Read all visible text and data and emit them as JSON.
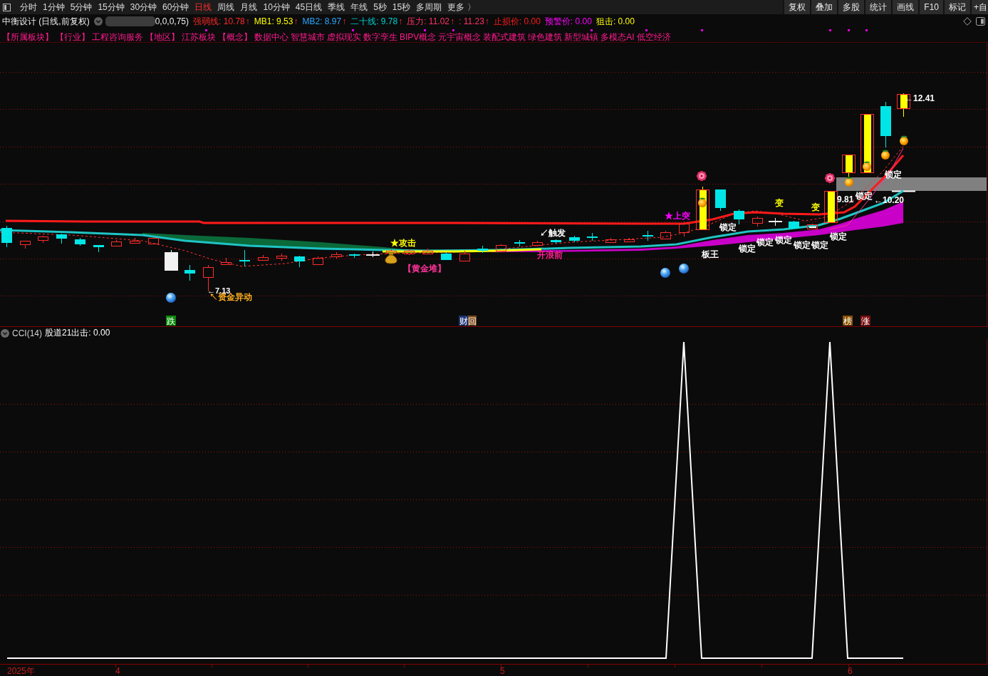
{
  "toolbar": {
    "periods": [
      {
        "label": "分时",
        "selected": false
      },
      {
        "label": "1分钟",
        "selected": false
      },
      {
        "label": "5分钟",
        "selected": false
      },
      {
        "label": "15分钟",
        "selected": false
      },
      {
        "label": "30分钟",
        "selected": false
      },
      {
        "label": "60分钟",
        "selected": false
      },
      {
        "label": "日线",
        "selected": true
      },
      {
        "label": "周线",
        "selected": false
      },
      {
        "label": "月线",
        "selected": false
      },
      {
        "label": "10分钟",
        "selected": false
      },
      {
        "label": "45日线",
        "selected": false
      },
      {
        "label": "季线",
        "selected": false
      },
      {
        "label": "年线",
        "selected": false
      },
      {
        "label": "5秒",
        "selected": false
      },
      {
        "label": "15秒",
        "selected": false
      },
      {
        "label": "多周期",
        "selected": false
      },
      {
        "label": "更多 〉",
        "selected": false
      }
    ],
    "buttons": [
      "复权",
      "叠加",
      "多股",
      "统计",
      "画线",
      "F10",
      "标记",
      "+自"
    ]
  },
  "quote_bar": {
    "title": "中衡设计 (日线,前复权)",
    "params": "0,0,0,75)",
    "readings": [
      {
        "text": "强弱线: 10.78",
        "arrow": "↑",
        "color": "#ff2a2a"
      },
      {
        "text": "MB1: 9.53",
        "arrow": "↑",
        "color": "#ffff00"
      },
      {
        "text": "MB2: 8.97",
        "arrow": "↑",
        "color": "#2aa8ff"
      },
      {
        "text": "二十线: 9.78",
        "arrow": "↑",
        "color": "#00d0d0"
      },
      {
        "text": "压力: 11.02",
        "arrow": "↑",
        "color": "#ff3366"
      },
      {
        "text": ": 11.23",
        "arrow": "↑",
        "color": "#ff3366"
      },
      {
        "text": "止损价: 0.00",
        "color": "#ff1a1a"
      },
      {
        "text": "预警价: 0.00",
        "color": "#ff00ff"
      },
      {
        "text": "狙击: 0.00",
        "color": "#ffff00"
      }
    ]
  },
  "sector_tags": [
    "【所属板块】",
    "【行业】",
    "工程咨询服务",
    "【地区】",
    "江苏板块",
    "【概念】",
    "数据中心",
    "智慧城市",
    "虚拟现实",
    "数字孪生",
    "BIPV概念",
    "元宇宙概念",
    "装配式建筑",
    "绿色建筑",
    "新型城镇",
    "多模态AI",
    "低空经济"
  ],
  "main_chart": {
    "annotations": [
      {
        "text": "←7.13",
        "color": "#ffffff"
      },
      {
        "text": "↖资金异动",
        "color": "#ffb020"
      },
      {
        "text": "★攻击",
        "color": "#ffff00"
      },
      {
        "text": "【黄金堆】",
        "color": "#ff3399"
      },
      {
        "text": "↙触发",
        "color": "#ffffff"
      },
      {
        "text": "开浪前",
        "color": "#ff2090"
      },
      {
        "text": "★上突",
        "color": "#ff00ff"
      },
      {
        "text": "板王",
        "color": "#ffffff"
      },
      {
        "text": "锁定",
        "color": "#ffffff"
      },
      {
        "text": "锁定",
        "color": "#ffffff"
      },
      {
        "text": "锁定",
        "color": "#ffffff"
      },
      {
        "text": "变",
        "color": "#ffff00"
      },
      {
        "text": "锁定",
        "color": "#ffffff"
      },
      {
        "text": "锁定",
        "color": "#ffffff"
      },
      {
        "text": "变",
        "color": "#ffff00"
      },
      {
        "text": "锁定",
        "color": "#ffffff"
      },
      {
        "text": "锁定",
        "color": "#ffffff"
      },
      {
        "text": "9.81",
        "color": "#ffffff"
      },
      {
        "text": "锁定",
        "color": "#ffffff"
      },
      {
        "text": "←10.20",
        "color": "#ffffff"
      },
      {
        "text": "锁定",
        "color": "#ffffff"
      },
      {
        "text": "←12.41",
        "color": "#ffffff"
      }
    ],
    "badges": [
      {
        "text": "跌",
        "color": "#0a8a0a"
      },
      {
        "text": "财",
        "color": "#1c3272"
      },
      {
        "text": "回",
        "color": "#7a4818"
      },
      {
        "text": "榜",
        "color": "#8a5000"
      },
      {
        "text": "涨",
        "color": "#7a1010"
      }
    ]
  },
  "lower_panel": {
    "title": "CCI(14)",
    "reading": "股道21出击: 0.00"
  },
  "time_axis": [
    "2025年",
    "4",
    "5",
    "6"
  ]
}
